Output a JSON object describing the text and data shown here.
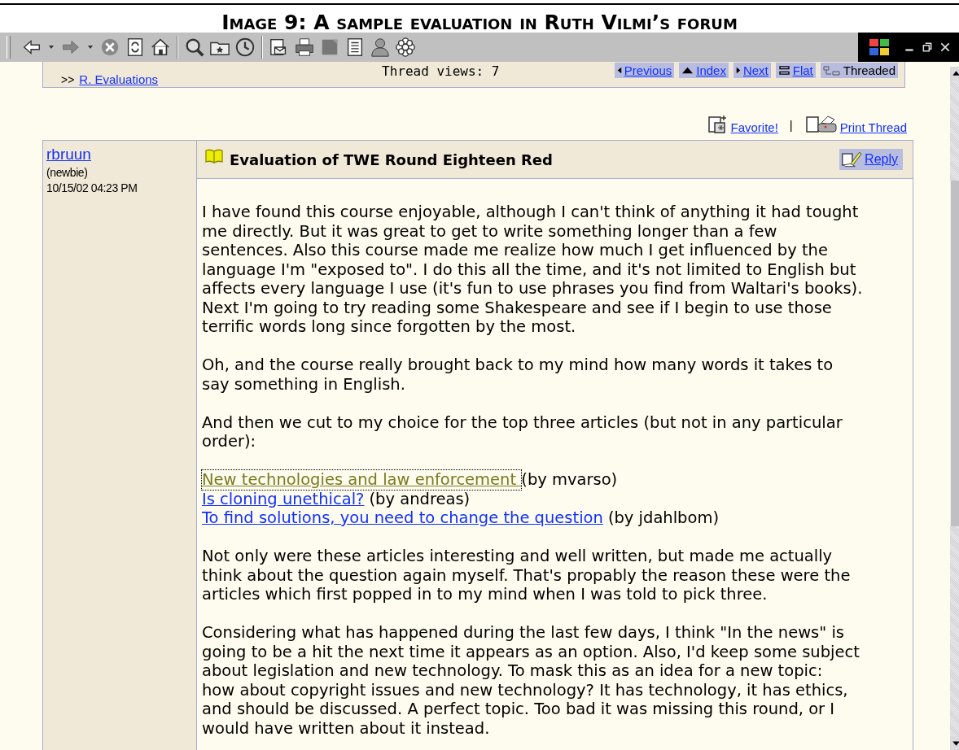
{
  "caption": "Image 9: A sample evaluation in Ruth Vilmi’s forum",
  "thread_header": {
    "breadcrumb_prefix": ">>",
    "breadcrumb_link": "R. Evaluations",
    "views": "Thread views: 7",
    "nav": [
      {
        "label": "Previous",
        "selected": false
      },
      {
        "label": "Index",
        "selected": false
      },
      {
        "label": "Next",
        "selected": false
      },
      {
        "label": "Flat",
        "selected": false
      },
      {
        "label": "Threaded",
        "selected": true
      }
    ]
  },
  "thread_actions": [
    {
      "label": "Favorite!"
    },
    {
      "label": "Print Thread"
    }
  ],
  "thread_actions_separator": "|",
  "post": {
    "author": "rbruun",
    "rank": "(newbie)",
    "date": "10/15/02 04:23 PM",
    "subject": "Evaluation of TWE Round Eighteen Red",
    "reply": "Reply",
    "body": [
      {
        "kind": "paragraph",
        "lines": [
          "I have found this course enjoyable, although I can't think of anything it had tought",
          "me directly. But it was great to get to write something longer than a few",
          "sentences. Also this course made me realize how much I get influenced by the",
          "language I'm \"exposed to\". I do this all the time, and it's not limited to English but",
          "affects every language I use (it's fun to use phrases you find from Waltari's books).",
          "Next I'm going to try reading some Shakespeare and see if I begin to use those",
          "terrific words long since forgotten by the most."
        ]
      },
      {
        "kind": "paragraph",
        "lines": [
          "Oh, and the course really brought back to my mind how many words it takes to",
          "say something in English."
        ]
      },
      {
        "kind": "paragraph",
        "lines": [
          "And then we cut to my choice for the top three articles (but not in any particular",
          "order):"
        ]
      },
      {
        "kind": "links",
        "items": [
          {
            "title": "New technologies and law enforcement ",
            "by": "(by mvarso)",
            "visited": true,
            "focused": true
          },
          {
            "title": "Is cloning unethical?",
            "by": "(by andreas)",
            "visited": false,
            "focused": false
          },
          {
            "title": "To find solutions, you need to change the question",
            "by": "(by jdahlbom)",
            "visited": false,
            "focused": false
          }
        ]
      },
      {
        "kind": "paragraph",
        "lines": [
          "Not only were these articles interesting and well written, but made me actually",
          "think about the question again myself. That's propably the reason these were the",
          "articles which first popped in to my mind when I was told to pick three."
        ]
      },
      {
        "kind": "paragraph",
        "lines": [
          "Considering what has happened during the last few days, I think \"In the news\" is",
          "going to be a hit the next time it appears as an option. Also, I'd keep some subject",
          "about legislation and new technology. To mask this as an idea for a new topic:",
          "how about copyright issues and new technology? It has technology, it has ethics,",
          "and should be discussed. A perfect topic. Too bad it was missing this round, or I",
          "would have written about it instead."
        ]
      }
    ]
  }
}
